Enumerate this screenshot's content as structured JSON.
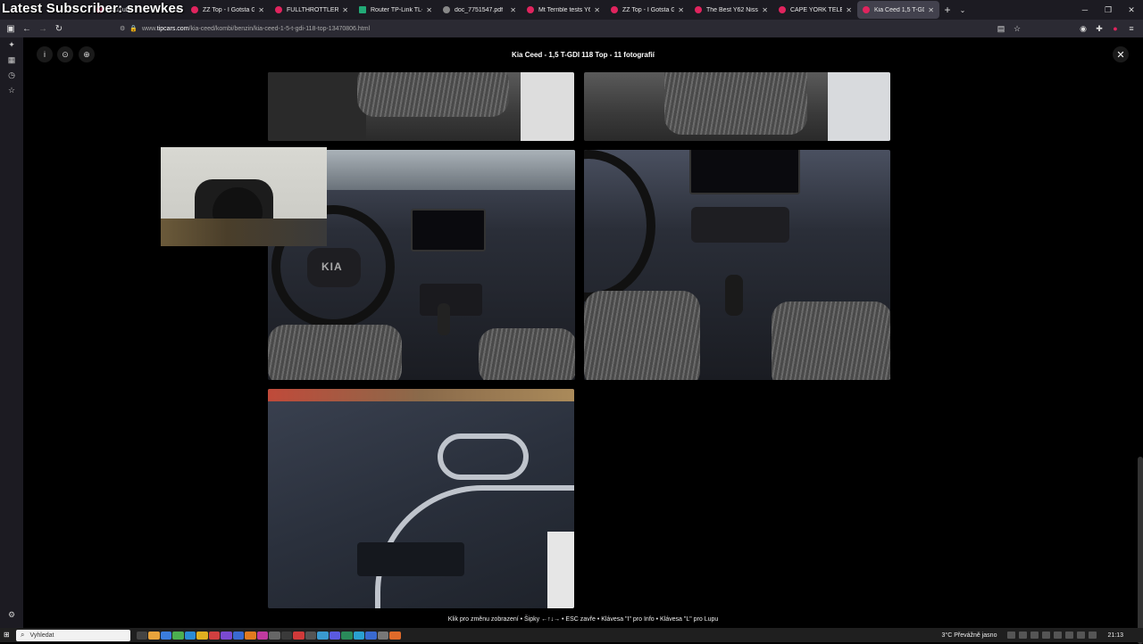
{
  "overlay": {
    "title": "Latest Subscriber: snewkes"
  },
  "tabs": [
    {
      "label": "YouTube",
      "fav": "youtube-icon"
    },
    {
      "label": "ZZ Top - I Gotsta Ge",
      "fav": "youtube-icon"
    },
    {
      "label": "FULLTHROTTLERICK - Yo",
      "fav": "youtube-icon"
    },
    {
      "label": "Router TP-Link TL-WR3",
      "fav": "router-icon"
    },
    {
      "label": "doc_7751547.pdf",
      "fav": "pdf-icon"
    },
    {
      "label": "Mt Terrible tests Y62 Ni",
      "fav": "youtube-icon"
    },
    {
      "label": "ZZ Top - I Gotsta Ge",
      "fav": "youtube-icon"
    },
    {
      "label": "The Best Y62 Nissan",
      "fav": "youtube-icon"
    },
    {
      "label": "CAPE YORK TELE TRACK",
      "fav": "youtube-icon"
    },
    {
      "label": "Kia Ceed 1,5 T-GDI 118",
      "fav": "tipcars-icon",
      "active": true
    }
  ],
  "url": {
    "prefix": "www.",
    "host": "tipcars.com",
    "path": "/kia-ceed/kombi/benzin/kia-ceed-1-5-t-gdi-118-top-13470806.html"
  },
  "viewer": {
    "title": "Kia Ceed - 1,5 T-GDI 118 Top - 11 fotografií",
    "btn_info": "i",
    "close": "✕"
  },
  "photo_alt": {
    "p1": "rear seats",
    "p2": "rear seat left",
    "p3": "dashboard with steering wheel",
    "p4": "center console",
    "p5": "door panel"
  },
  "statusbar": {
    "text": "Klik pro změnu zobrazení • Šipky ←↑↓→ • ESC zavře • Klávesa \"I\" pro Info • Klávesa \"L\" pro Lupu"
  },
  "taskbar": {
    "search_placeholder": "Vyhledat",
    "weather": "3°C  Převážně jasno",
    "time": "21:13"
  },
  "colors": {
    "accent": "#e0245e",
    "background": "#000000"
  }
}
